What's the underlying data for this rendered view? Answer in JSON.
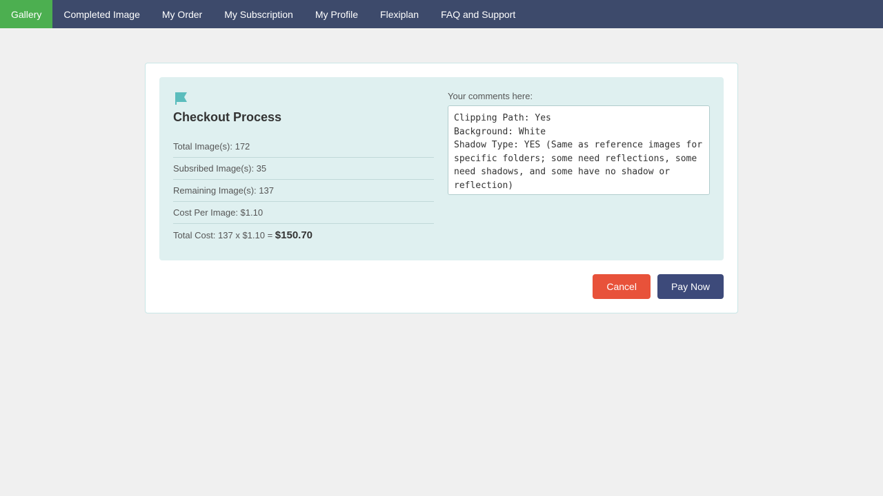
{
  "nav": {
    "items": [
      {
        "label": "Gallery",
        "active": true
      },
      {
        "label": "Completed Image",
        "active": false
      },
      {
        "label": "My Order",
        "active": false
      },
      {
        "label": "My Subscription",
        "active": false
      },
      {
        "label": "My Profile",
        "active": false
      },
      {
        "label": "Flexiplan",
        "active": false
      },
      {
        "label": "FAQ and Support",
        "active": false
      }
    ]
  },
  "checkout": {
    "title": "Checkout Process",
    "total_images_label": "Total Image(s): 172",
    "subscribed_images_label": "Subsribed Image(s): 35",
    "remaining_images_label": "Remaining Image(s): 137",
    "cost_per_image_label": "Cost Per Image: $1.10",
    "total_cost_label": "Total Cost: 137 x $1.10 = ",
    "total_cost_bold": "$150.70",
    "comments_label": "Your comments here:",
    "comments_text": "Clipping Path: Yes\nBackground: White\nShadow Type: YES (Same as reference images for specific folders; some need reflections, some need shadows, and some have no shadow or reflection)\nRetouching: NONE",
    "cancel_button": "Cancel",
    "pay_button": "Pay Now"
  }
}
